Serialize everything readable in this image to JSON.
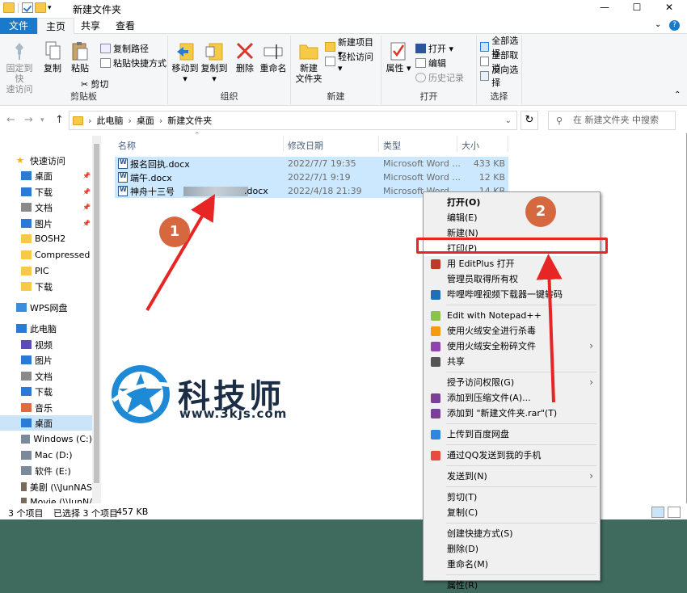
{
  "window": {
    "title": "新建文件夹",
    "minimize": "—",
    "maximize": "☐",
    "close": "✕"
  },
  "tabs": [
    "文件",
    "主页",
    "共享",
    "查看"
  ],
  "ribbon": {
    "clipboard": {
      "label": "剪贴板",
      "pin": "固定到快\n速访问",
      "copy": "复制",
      "paste": "粘贴",
      "copy_path": "复制路径",
      "paste_shortcut": "粘贴快捷方式",
      "cut": "剪切"
    },
    "organize": {
      "label": "组织",
      "move_to": "移动到",
      "copy_to": "复制到",
      "delete": "删除",
      "rename": "重命名"
    },
    "new": {
      "label": "新建",
      "new_folder": "新建\n文件夹",
      "new_item": "新建项目 ▾",
      "easy_access": "轻松访问 ▾"
    },
    "open": {
      "label": "打开",
      "properties": "属性",
      "open": "打开 ▾",
      "edit": "编辑",
      "history": "历史记录"
    },
    "select": {
      "label": "选择",
      "select_all": "全部选择",
      "select_none": "全部取消",
      "invert": "反向选择"
    }
  },
  "address": {
    "crumbs": [
      "此电脑",
      "桌面",
      "新建文件夹"
    ],
    "search_placeholder": "在 新建文件夹 中搜索"
  },
  "nav": [
    {
      "label": "快速访问",
      "icon": "star-icon"
    },
    {
      "label": "桌面",
      "icon": "desktop-icon"
    },
    {
      "label": "下载",
      "icon": "download-icon"
    },
    {
      "label": "文档",
      "icon": "document-icon"
    },
    {
      "label": "图片",
      "icon": "picture-icon"
    },
    {
      "label": "BOSH2",
      "icon": "folder-icon"
    },
    {
      "label": "Compressed",
      "icon": "folder-icon"
    },
    {
      "label": "PIC",
      "icon": "folder-icon"
    },
    {
      "label": "下载",
      "icon": "folder-icon"
    },
    {
      "label": "WPS网盘",
      "icon": "cloud-icon"
    },
    {
      "label": "此电脑",
      "icon": "computer-icon"
    },
    {
      "label": "视频",
      "icon": "video-icon"
    },
    {
      "label": "图片",
      "icon": "picture-icon"
    },
    {
      "label": "文档",
      "icon": "document-icon"
    },
    {
      "label": "下载",
      "icon": "download-icon"
    },
    {
      "label": "音乐",
      "icon": "music-icon"
    },
    {
      "label": "桌面",
      "icon": "desktop-icon"
    },
    {
      "label": "Windows (C:)",
      "icon": "drive-icon"
    },
    {
      "label": "Mac (D:)",
      "icon": "drive-icon"
    },
    {
      "label": "软件 (E:)",
      "icon": "drive-icon"
    },
    {
      "label": "美剧 (\\\\JunNAS",
      "icon": "network-drive-icon"
    },
    {
      "label": "Movie (\\\\JunN/",
      "icon": "network-drive-icon"
    }
  ],
  "columns": {
    "name": "名称",
    "date": "修改日期",
    "type": "类型",
    "size": "大小"
  },
  "files": [
    {
      "name": "报名回执.docx",
      "date": "2022/7/7 19:35",
      "type": "Microsoft Word ...",
      "size": "433 KB"
    },
    {
      "name": "端午.docx",
      "date": "2022/7/1 9:19",
      "type": "Microsoft Word ...",
      "size": "12 KB"
    },
    {
      "name": "神舟十三号",
      "name_suffix": ".docx",
      "date": "2022/4/18 21:39",
      "type": "Microsoft Word ...",
      "size": "14 KB"
    }
  ],
  "status": {
    "count": "3 个项目",
    "selected": "已选择 3 个项目",
    "size": "457 KB"
  },
  "context_menu": [
    {
      "label": "打开(O)",
      "bold": true
    },
    {
      "label": "编辑(E)"
    },
    {
      "label": "新建(N)"
    },
    {
      "label": "打印(P)",
      "highlight": true
    },
    {
      "label": "用 EditPlus 打开",
      "icon": "editplus-icon"
    },
    {
      "label": "管理员取得所有权"
    },
    {
      "label": "哔哩哔哩视频下载器一键转码",
      "icon": "bilibili-icon"
    },
    {
      "sep": true
    },
    {
      "label": "Edit with Notepad++",
      "icon": "notepad-icon"
    },
    {
      "label": "使用火绒安全进行杀毒",
      "icon": "huorong-icon"
    },
    {
      "label": "使用火绒安全粉碎文件",
      "icon": "shred-icon",
      "arrow": true
    },
    {
      "label": "共享",
      "icon": "share-icon"
    },
    {
      "sep": true
    },
    {
      "label": "授予访问权限(G)",
      "arrow": true
    },
    {
      "label": "添加到压缩文件(A)...",
      "icon": "winrar-icon"
    },
    {
      "label": "添加到 \"新建文件夹.rar\"(T)",
      "icon": "winrar-icon"
    },
    {
      "sep": true
    },
    {
      "label": "上传到百度网盘",
      "icon": "baidu-icon"
    },
    {
      "sep": true
    },
    {
      "label": "通过QQ发送到我的手机",
      "icon": "qq-icon"
    },
    {
      "sep": true
    },
    {
      "label": "发送到(N)",
      "arrow": true
    },
    {
      "sep": true
    },
    {
      "label": "剪切(T)"
    },
    {
      "label": "复制(C)"
    },
    {
      "sep": true
    },
    {
      "label": "创建快捷方式(S)"
    },
    {
      "label": "删除(D)"
    },
    {
      "label": "重命名(M)"
    },
    {
      "sep": true
    },
    {
      "label": "属性(R)"
    }
  ],
  "annotations": {
    "badge1": "1",
    "badge2": "2"
  },
  "watermark": {
    "text": "科技师",
    "url": "www.3kjs.com"
  }
}
